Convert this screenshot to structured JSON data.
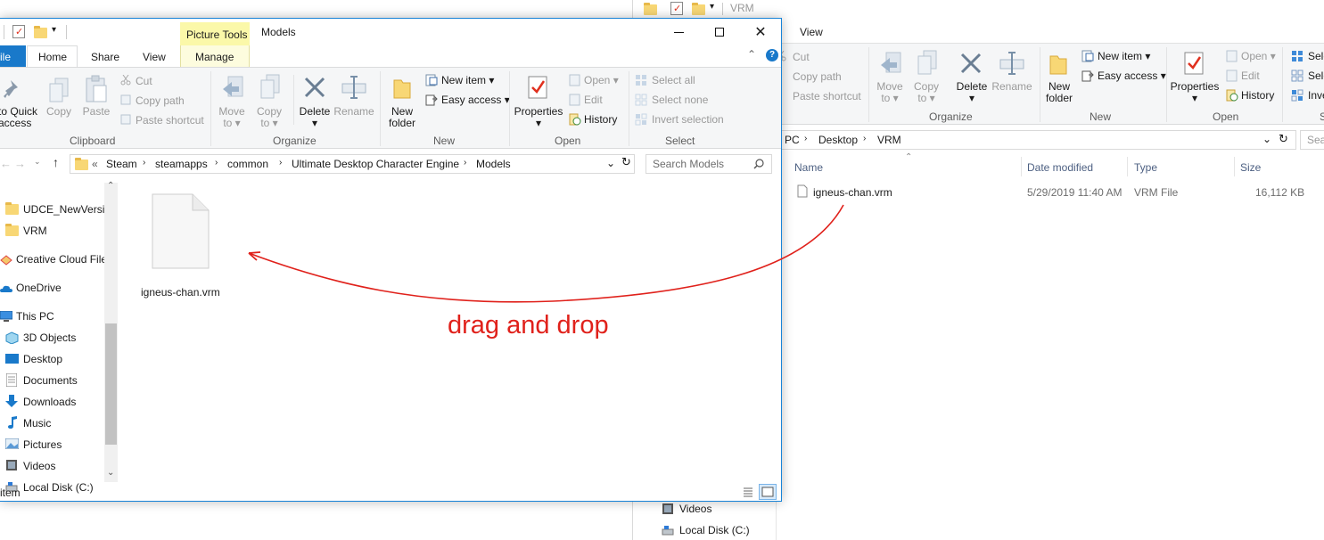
{
  "right_window": {
    "title": "VRM",
    "tabs": {
      "view": "View"
    },
    "clipboard": {
      "cut": "Cut",
      "copy_path": "Copy path",
      "paste_shortcut": "Paste shortcut"
    },
    "organize": {
      "move": "Move",
      "to1": "to",
      "copy": "Copy",
      "to2": "to",
      "delete": "Delete",
      "rename": "Rename",
      "label": "Organize"
    },
    "new": {
      "new_folder_1": "New",
      "new_folder_2": "folder",
      "new_item": "New item",
      "easy_access": "Easy access",
      "label": "New"
    },
    "open": {
      "properties": "Properties",
      "open": "Open",
      "edit": "Edit",
      "history": "History",
      "label": "Open"
    },
    "select": {
      "select_all": "Sele",
      "select_none": "Sele",
      "invert": "Inve",
      "label": "S"
    },
    "address": {
      "c1": "PC",
      "c2": "Desktop",
      "c3": "VRM",
      "search": "Sea"
    },
    "columns": {
      "name": "Name",
      "date": "Date modified",
      "type": "Type",
      "size": "Size"
    },
    "file": {
      "name": "igneus-chan.vrm",
      "date": "5/29/2019 11:40 AM",
      "type": "VRM File",
      "size": "16,112 KB"
    },
    "nav": {
      "videos": "Videos",
      "local_disk": "Local Disk (C:)"
    }
  },
  "left_window": {
    "context_tab": "Picture Tools",
    "title": "Models",
    "tabs": {
      "file": "ile",
      "home": "Home",
      "share": "Share",
      "view": "View",
      "manage": "Manage"
    },
    "clipboard": {
      "pin_1": "to Quick",
      "pin_2": "access",
      "copy": "Copy",
      "paste": "Paste",
      "cut": "Cut",
      "copy_path": "Copy path",
      "paste_shortcut": "Paste shortcut",
      "label": "Clipboard"
    },
    "organize": {
      "move": "Move",
      "to1": "to",
      "copy": "Copy",
      "to2": "to",
      "delete": "Delete",
      "rename": "Rename",
      "label": "Organize"
    },
    "new": {
      "new_folder_1": "New",
      "new_folder_2": "folder",
      "new_item": "New item",
      "easy_access": "Easy access",
      "label": "New"
    },
    "open": {
      "properties": "Properties",
      "open": "Open",
      "edit": "Edit",
      "history": "History",
      "label": "Open"
    },
    "select": {
      "select_all": "Select all",
      "select_none": "Select none",
      "invert": "Invert selection",
      "label": "Select"
    },
    "address": {
      "overflow": "«",
      "crumbs": [
        "Steam",
        "steamapps",
        "common",
        "Ultimate Desktop Character Engine",
        "Models"
      ],
      "search_placeholder": "Search Models"
    },
    "nav": [
      "UDCE_NewVersio",
      "VRM",
      "Creative Cloud File",
      "OneDrive",
      "This PC",
      "3D Objects",
      "Desktop",
      "Documents",
      "Downloads",
      "Music",
      "Pictures",
      "Videos",
      "Local Disk (C:)"
    ],
    "file": {
      "name": "igneus-chan.vrm"
    },
    "status": "item"
  },
  "annotation": {
    "text": "drag and drop",
    "color": "#e0211b"
  }
}
